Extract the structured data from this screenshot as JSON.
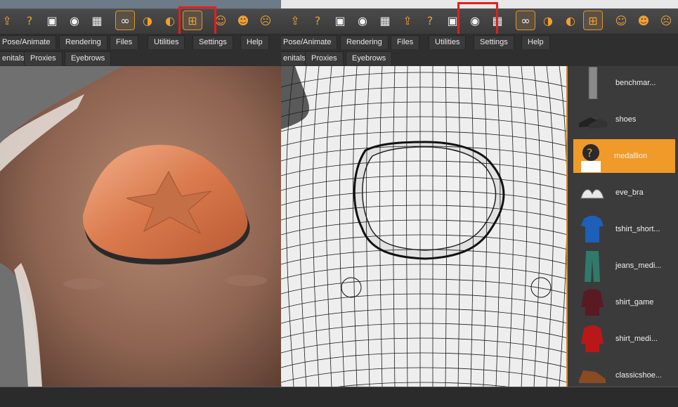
{
  "toolbar": {
    "left_buttons": [
      {
        "icon": "import-icon",
        "glyph": "⇪"
      },
      {
        "icon": "help-icon",
        "glyph": "?"
      },
      {
        "icon": "save-icon",
        "glyph": "▣"
      },
      {
        "icon": "camera-icon",
        "glyph": "◉"
      },
      {
        "icon": "checker-icon",
        "glyph": "▦"
      },
      {
        "icon": "glasses-icon",
        "glyph": "∞"
      },
      {
        "icon": "wireframe-glasses-icon",
        "glyph": "◑"
      },
      {
        "icon": "glasses-variant-icon",
        "glyph": "◐"
      },
      {
        "icon": "wireframe-mesh-icon",
        "glyph": "⊞"
      },
      {
        "icon": "face-forward-icon",
        "glyph": "☺"
      },
      {
        "icon": "face-back-icon",
        "glyph": "☻"
      },
      {
        "icon": "face-equal-icon",
        "glyph": "☹"
      }
    ],
    "right_extra_buttons": [
      {
        "icon": "head-front-icon",
        "glyph": "☺"
      },
      {
        "icon": "head-side-icon",
        "glyph": "☻"
      },
      {
        "icon": "head-left-icon",
        "glyph": "◔"
      },
      {
        "icon": "head-right-icon",
        "glyph": "◕"
      },
      {
        "icon": "head-top-icon",
        "glyph": "◓"
      }
    ]
  },
  "menu": {
    "tabs": [
      "Pose/Animate",
      "Rendering",
      "Files",
      "Utilities",
      "Settings",
      "Help"
    ]
  },
  "submenu": {
    "tabs": [
      "enitals",
      "Proxies",
      "Eyebrows"
    ]
  },
  "library": {
    "items": [
      {
        "label": "benchmar...",
        "icon": "stocking-icon",
        "selected": false
      },
      {
        "label": "shoes",
        "icon": "shoes-icon",
        "selected": false
      },
      {
        "label": "medallion",
        "icon": "question-thumb-icon",
        "selected": true
      },
      {
        "label": "eve_bra",
        "icon": "bra-icon",
        "selected": false
      },
      {
        "label": "tshirt_short...",
        "icon": "tshirt-icon",
        "selected": false
      },
      {
        "label": "jeans_medi...",
        "icon": "jeans-icon",
        "selected": false
      },
      {
        "label": "shirt_game",
        "icon": "shirt-icon",
        "selected": false
      },
      {
        "label": "shirt_medi...",
        "icon": "shirt-red-icon",
        "selected": false
      },
      {
        "label": "classicshoe...",
        "icon": "classic-shoe-icon",
        "selected": false
      }
    ]
  },
  "colors": {
    "accent": "#f09a2a",
    "highlight": "#e02020",
    "skin": "#a87a64",
    "medallion": "#e08a5c"
  }
}
